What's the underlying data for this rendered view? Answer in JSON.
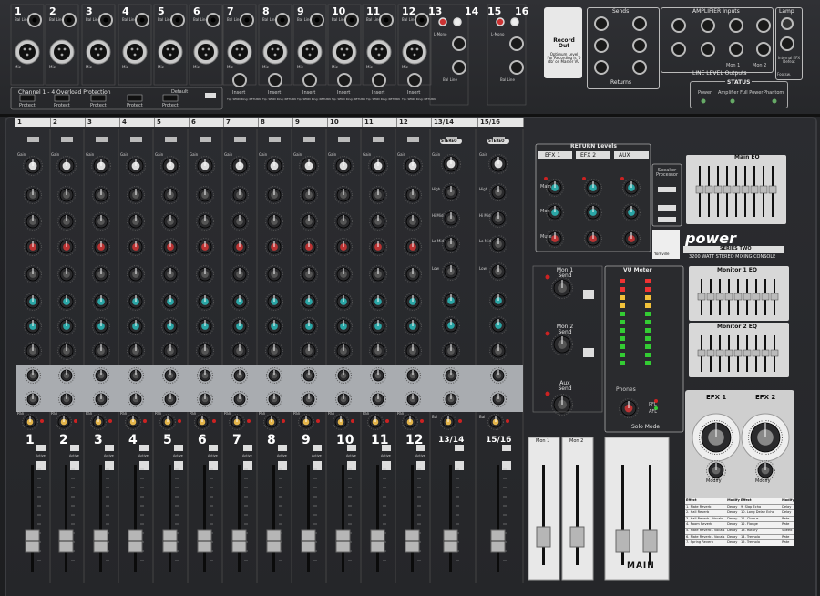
{
  "back_panel": {
    "channel_numbers": [
      "1",
      "2",
      "3",
      "4",
      "5",
      "6",
      "7",
      "8",
      "9",
      "10",
      "11",
      "12"
    ],
    "stereo_numbers": [
      "13",
      "14",
      "15",
      "16"
    ],
    "jack_label_top": "Bal Line",
    "jack_label_mic": "Mic",
    "insert_label": "Insert",
    "insert_sub": "Tip: SEND Ring: RETURN",
    "overload_title": "Channel 1 - 4 Overload Protection",
    "overload_default": "Default",
    "protect_label": "Protect",
    "l_mono": "L-Mono",
    "bal_line_in": "Bal Line",
    "record_title": "Record Out",
    "record_text": "Optimum Level For Recording is '0 db' on Master VU",
    "sends_title": "Sends",
    "returns_title": "Returns",
    "amp_inputs_title": "AMPLIFIER Inputs",
    "line_level_outputs": "LINE LEVEL Outputs",
    "mon1": "Mon 1",
    "mon2": "Mon 2",
    "lamp_title": "Lamp",
    "lamp_sub": "Internal EFX Defeat",
    "footsw": "Footsw.",
    "status_title": "STATUS",
    "status_items": [
      "Power",
      "Amplifier Full Power",
      "Phantom"
    ]
  },
  "top_tabs": [
    "1",
    "2",
    "3",
    "4",
    "5",
    "6",
    "7",
    "8",
    "9",
    "10",
    "11",
    "12",
    "13/14",
    "15/16"
  ],
  "channel_strip": {
    "mono_labels": [
      "1",
      "2",
      "3",
      "4",
      "5",
      "6",
      "7",
      "8",
      "9",
      "10",
      "11",
      "12"
    ],
    "stereo_labels": [
      "13/14",
      "15/16"
    ],
    "stereo_badge": "STEREO",
    "gain_label": "Gain",
    "eq_labels": [
      "High",
      "Hi Mid",
      "Lo Mid",
      "Low"
    ],
    "pan_label": "Pan",
    "bal_label": "Bal",
    "clip_label": "Clip",
    "solo_label": "Solo",
    "active_label": "Active",
    "fader_scale": [
      "10",
      "5",
      "0",
      "5",
      "10",
      "15",
      "20",
      "30",
      "40",
      "60",
      "∞"
    ]
  },
  "return_levels": {
    "title": "RETURN Levels",
    "cols": [
      "EFX 1",
      "EFX 2",
      "AUX"
    ],
    "rows": [
      "Main",
      "Mon",
      "Mute"
    ]
  },
  "speaker_processor": "Speaker Processor",
  "main_eq_title": "Main EQ",
  "brand": {
    "logo": "Yorkville",
    "name": "power",
    "series": "SERIES TWO",
    "subtitle": "3200 WATT STEREO MIXING CONSOLE"
  },
  "mon1_send": "Mon 1 Send",
  "mon2_send": "Mon 2 Send",
  "aux_send": "Aux Send",
  "vu_title": "VU Meter",
  "phones": "Phones",
  "solo_mode": "Solo Mode",
  "pfl_label": "PFL",
  "afl_label": "AFL",
  "monitor1_eq": "Monitor 1 EQ",
  "monitor2_eq": "Monitor 2 EQ",
  "efx_labels": [
    "EFX 1",
    "EFX 2"
  ],
  "modify_label": "Modify",
  "efx_table": {
    "headers": [
      "Effect",
      "Modify",
      "Effect",
      "Modify"
    ],
    "rows": [
      [
        "1. Plate Reverb",
        "Decay",
        "9. Slap Echo",
        "Delay"
      ],
      [
        "2. Hall Reverb",
        "Decay",
        "10. Long Delay Echo",
        "Delay"
      ],
      [
        "3. Hall Reverb - Vocals",
        "Decay",
        "11. Chorus",
        "Rate"
      ],
      [
        "4. Room Reverb",
        "Decay",
        "12. Flange",
        "Rate"
      ],
      [
        "5. Plate Reverb - Vocals",
        "Decay",
        "13. Rotary",
        "Speed"
      ],
      [
        "6. Plate Reverb - Vocals",
        "Decay",
        "14. Tremolo",
        "Rate"
      ],
      [
        "7. Spring Reverb",
        "Decay",
        "15. Tremolo",
        "Rate"
      ],
      [
        "8. Gated Reverb",
        "Decay",
        "16. Pitchshift",
        "Shift"
      ]
    ]
  },
  "main_label": "MAIN",
  "sub_labels": [
    "Mon 1",
    "Mon 2"
  ]
}
